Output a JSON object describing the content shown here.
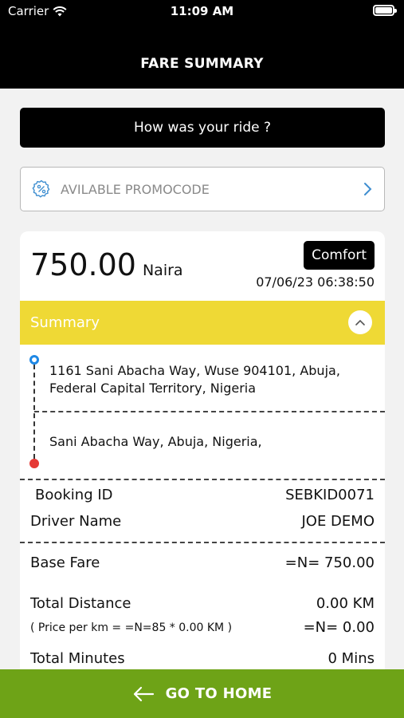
{
  "status_bar": {
    "carrier": "Carrier",
    "time": "11:09 AM"
  },
  "header": {
    "title": "FARE SUMMARY"
  },
  "rate": {
    "label": "How was your ride ?"
  },
  "promo": {
    "label": "AVILABLE PROMOCODE",
    "icon": "percent-badge-icon"
  },
  "fare": {
    "amount": "750.00",
    "currency": "Naira",
    "vehicle_type": "Comfort",
    "datetime": "07/06/23 06:38:50"
  },
  "summary": {
    "label": "Summary",
    "pickup": "1161 Sani Abacha Way, Wuse 904101, Abuja, Federal Capital Territory, Nigeria",
    "dropoff": "Sani Abacha Way, Abuja, Nigeria,",
    "booking_id_label": "Booking ID",
    "booking_id": "SEBKID0071",
    "driver_name_label": "Driver Name",
    "driver_name": "JOE DEMO",
    "base_fare_label": "Base Fare",
    "base_fare": "=N= 750.00",
    "total_distance_label": "Total Distance",
    "total_distance": "0.00 KM",
    "price_per_km_label": "( Price per km = =N=85 * 0.00 KM )",
    "price_per_km_value": "=N= 0.00",
    "total_minutes_label": "Total Minutes",
    "total_minutes": "0 Mins"
  },
  "footer": {
    "home_label": "GO TO HOME"
  },
  "colors": {
    "accent_yellow": "#efd935",
    "home_green": "#6ea317",
    "pickup_blue": "#1e88e5",
    "drop_red": "#e53935"
  }
}
